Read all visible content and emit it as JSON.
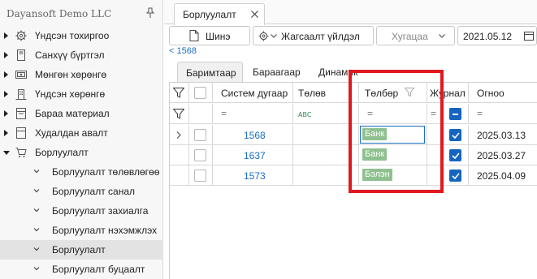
{
  "sidebar": {
    "company": "Dayansoft Demo LLC",
    "items": [
      {
        "label": "Үндсэн тохиргоо",
        "icon": "gear-icon"
      },
      {
        "label": "Санхүү бүртгэл",
        "icon": "ledger-icon"
      },
      {
        "label": "Мөнгөн хөрөнгө",
        "icon": "cash-icon"
      },
      {
        "label": "Үндсэн хөрөнгө",
        "icon": "building-icon"
      },
      {
        "label": "Бараа материал",
        "icon": "inventory-icon"
      },
      {
        "label": "Худалдан авалт",
        "icon": "purchase-icon"
      },
      {
        "label": "Борлуулалт",
        "icon": "cart-icon"
      }
    ],
    "subitems": [
      {
        "label": "Борлуулалт төлөвлөгөө"
      },
      {
        "label": "Борлуулалт санал"
      },
      {
        "label": "Борлуулалт захиалга"
      },
      {
        "label": "Борлуулалт нэхэмжлэх"
      },
      {
        "label": "Борлуулалт"
      },
      {
        "label": "Борлуулалт буцаалт"
      }
    ]
  },
  "tab": {
    "label": "Борлуулалт"
  },
  "toolbar": {
    "new_label": "Шинэ",
    "actions_label": "Жагсаалт үйлдэл",
    "period_placeholder": "Хугацаа",
    "date_value": "2021.05.12"
  },
  "back_link": "< 1568",
  "section_tabs": [
    "Баримтаар",
    "Бараагаар",
    "Динамик"
  ],
  "grid": {
    "columns": [
      "Систем дугаар",
      "Төлөв",
      "Төлбөр",
      "Журнал",
      "Огноо"
    ],
    "filter_eq": "=",
    "rows": [
      {
        "number": "1568",
        "payment": "Банк",
        "date": "2025.03.13",
        "journal": true
      },
      {
        "number": "1637",
        "payment": "Банк",
        "date": "2025.03.27",
        "journal": true
      },
      {
        "number": "1573",
        "payment": "Бэлэн",
        "date": "2025.04.09",
        "journal": true
      }
    ]
  },
  "colors": {
    "accent": "#1a6fc2",
    "checkbox": "#1565c0",
    "badge": "#8fc08f",
    "highlight": "#e0191f"
  }
}
